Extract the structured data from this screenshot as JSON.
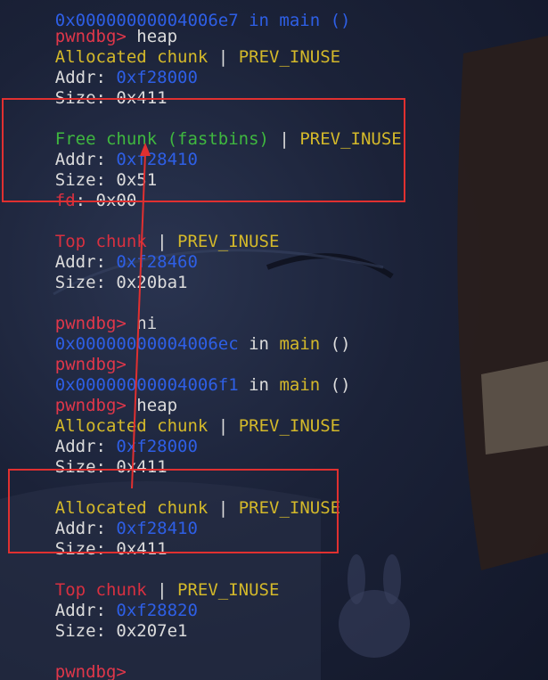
{
  "colors": {
    "prompt": "#e0374a",
    "text": "#dcdcdc",
    "yellow": "#d4b92a",
    "green": "#3fb83f",
    "red": "#d83040",
    "blue": "#2e5fe6",
    "highlight": "#e03030"
  },
  "terminal": {
    "partial_top": "0x00000000004006e7 in main ()",
    "prompt": "pwndbg>",
    "cmd_heap": " heap",
    "cmd_ni": " ni",
    "pipe": " | ",
    "prev_inuse": "PREV_INUSE",
    "allocated_chunk": "Allocated chunk",
    "free_chunk": "Free chunk (fastbins)",
    "top_chunk": "Top chunk",
    "addr_label": "Addr: ",
    "size_label": "Size: ",
    "fd_label": "fd",
    "fd_sep": ": ",
    "in_text": " in ",
    "main_text": "main",
    "paren_text": " ()",
    "heap1": {
      "alloc_addr": "0xf28000",
      "alloc_size": "0x411",
      "free_addr": "0xf28410",
      "free_size": "0x51",
      "free_fd": "0x00",
      "top_addr": "0xf28460",
      "top_size": "0x20ba1"
    },
    "ni_addr1": "0x00000000004006ec",
    "ni_addr2": "0x00000000004006f1",
    "heap2": {
      "alloc1_addr": "0xf28000",
      "alloc1_size": "0x411",
      "alloc2_addr": "0xf28410",
      "alloc2_size": "0x411",
      "top_addr": "0xf28820",
      "top_size": "0x207e1"
    }
  }
}
